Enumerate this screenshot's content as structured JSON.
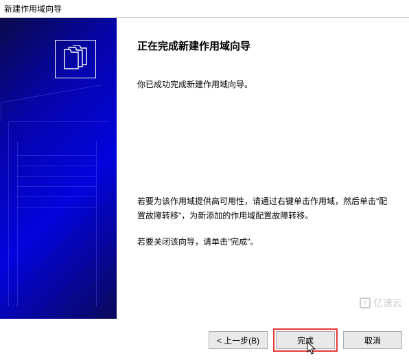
{
  "window": {
    "title": "新建作用域向导"
  },
  "sidebar": {
    "icon": "folders-icon"
  },
  "main": {
    "heading": "正在完成新建作用域向导",
    "success_msg": "你已成功完成新建作用域向导。",
    "ha_msg": "若要为该作用域提供高可用性，请通过右键单击作用域，然后单击\"配置故障转移\"，为新添加的作用域配置故障转移。",
    "close_msg": "若要关闭该向导，请单击\"完成\"。"
  },
  "buttons": {
    "back": "< 上一步(B)",
    "finish": "完成",
    "cancel": "取消"
  },
  "watermark": {
    "text": "亿速云"
  }
}
